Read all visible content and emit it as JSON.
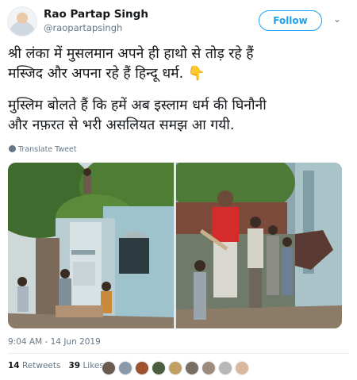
{
  "author": {
    "name": "Rao Partap Singh",
    "handle": "@raopartapsingh"
  },
  "actions": {
    "follow_label": "Follow",
    "menu_icon": "chevron-down-icon"
  },
  "tweet": {
    "paragraph_1": "श्री लंका में मुसलमान अपने ही हाथो से तोड़ रहे हैं\nमस्जिद और अपना रहे हैं हिन्दू धर्म. 👇",
    "paragraph_2": "मुस्लिम बोलते हैं कि हमें अब इस्लाम धर्म की घिनौनी\nऔर नफ़रत से भरी असलियत समझ आ गयी.",
    "translate_label": "Translate Tweet"
  },
  "timestamp": "9:04 AM - 14 Jun 2019",
  "stats": {
    "retweets_count": "14",
    "retweets_label": "Retweets",
    "likes_count": "39",
    "likes_label": "Likes"
  },
  "likers": [
    "#6b5b4e",
    "#8a9aa8",
    "#a0522d",
    "#4b5d3f",
    "#c0a060",
    "#7a6f64",
    "#9c8c7c",
    "#b8b8b8",
    "#d9b99b"
  ]
}
